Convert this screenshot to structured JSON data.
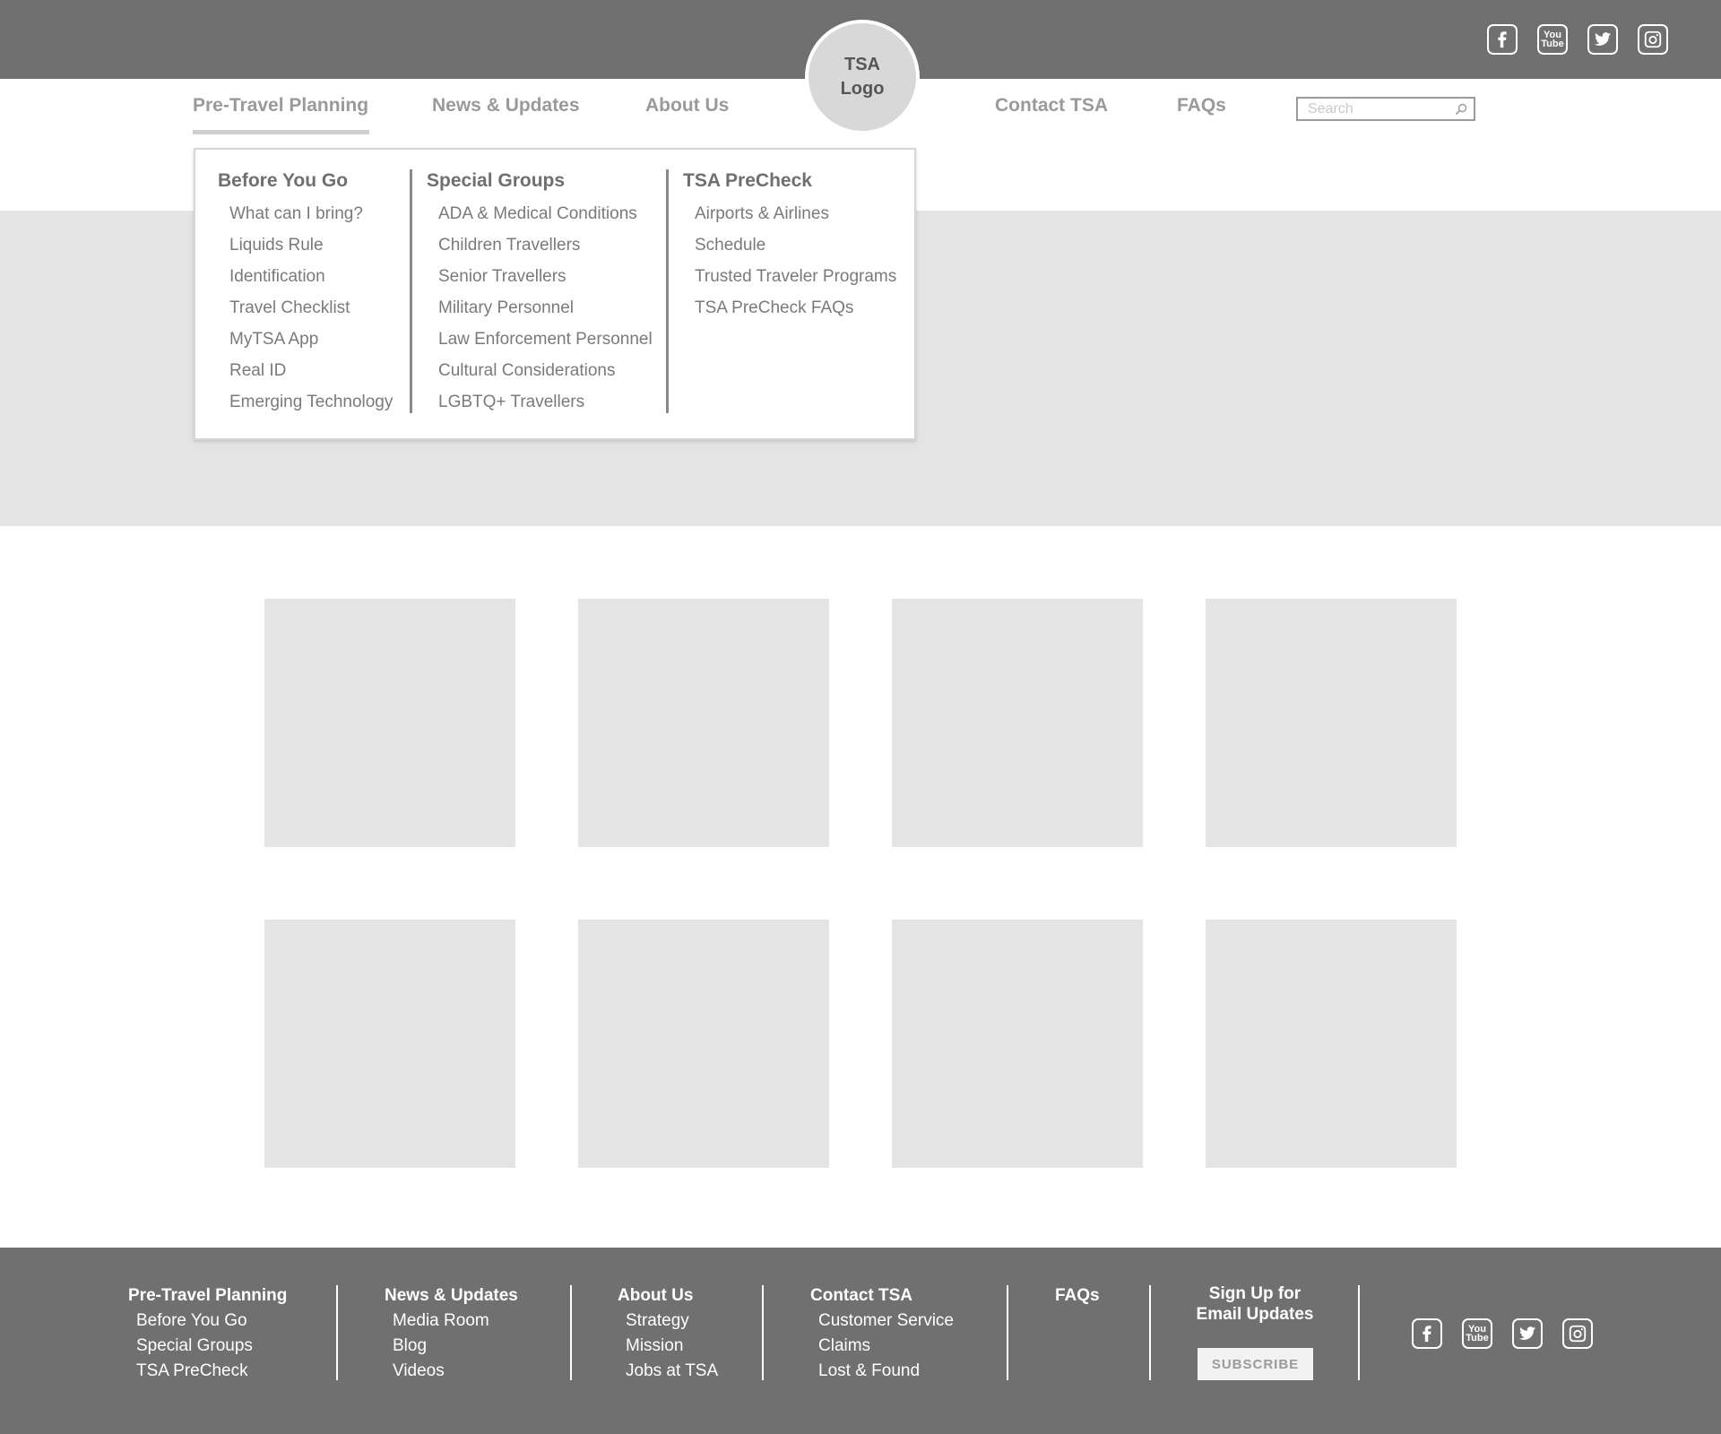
{
  "header": {
    "social_icons": [
      "facebook-icon",
      "youtube-icon",
      "twitter-icon",
      "instagram-icon"
    ],
    "youtube_text": [
      "You",
      "Tube"
    ]
  },
  "logo": {
    "line1": "TSA",
    "line2": "Logo"
  },
  "nav": {
    "items": [
      "Pre-Travel Planning",
      "News & Updates",
      "About Us",
      "Contact TSA",
      "FAQs"
    ],
    "active": "Pre-Travel Planning",
    "search_placeholder": "Search"
  },
  "dropdown": {
    "columns": [
      {
        "heading": "Before You Go",
        "links": [
          "What can I bring?",
          "Liquids Rule",
          "Identification",
          "Travel Checklist",
          "MyTSA App",
          "Real ID",
          "Emerging Technology"
        ]
      },
      {
        "heading": "Special Groups",
        "links": [
          "ADA & Medical Conditions",
          "Children Travellers",
          "Senior Travellers",
          "Military Personnel",
          "Law Enforcement Personnel",
          "Cultural Considerations",
          "LGBTQ+ Travellers"
        ]
      },
      {
        "heading": "TSA PreCheck",
        "links": [
          "Airports & Airlines",
          "Schedule",
          "Trusted Traveler Programs",
          "TSA PreCheck FAQs"
        ]
      }
    ]
  },
  "footer": {
    "columns": [
      {
        "heading": "Pre-Travel Planning",
        "links": [
          "Before You Go",
          "Special Groups",
          "TSA PreCheck"
        ]
      },
      {
        "heading": "News & Updates",
        "links": [
          "Media Room",
          "Blog",
          "Videos"
        ]
      },
      {
        "heading": "About Us",
        "links": [
          "Strategy",
          "Mission",
          "Jobs at TSA"
        ]
      },
      {
        "heading": "Contact TSA",
        "links": [
          "Customer Service",
          "Claims",
          "Lost & Found"
        ]
      },
      {
        "heading": "FAQs",
        "links": []
      }
    ],
    "signup_line1": "Sign Up for",
    "signup_line2": "Email Updates",
    "subscribe_label": "SUBSCRIBE",
    "social_icons": [
      "facebook-icon",
      "youtube-icon",
      "twitter-icon",
      "instagram-icon"
    ]
  },
  "colors": {
    "topbar": "#707070",
    "placeholder": "#e4e4e4",
    "nav_text": "#9a9a9a"
  }
}
